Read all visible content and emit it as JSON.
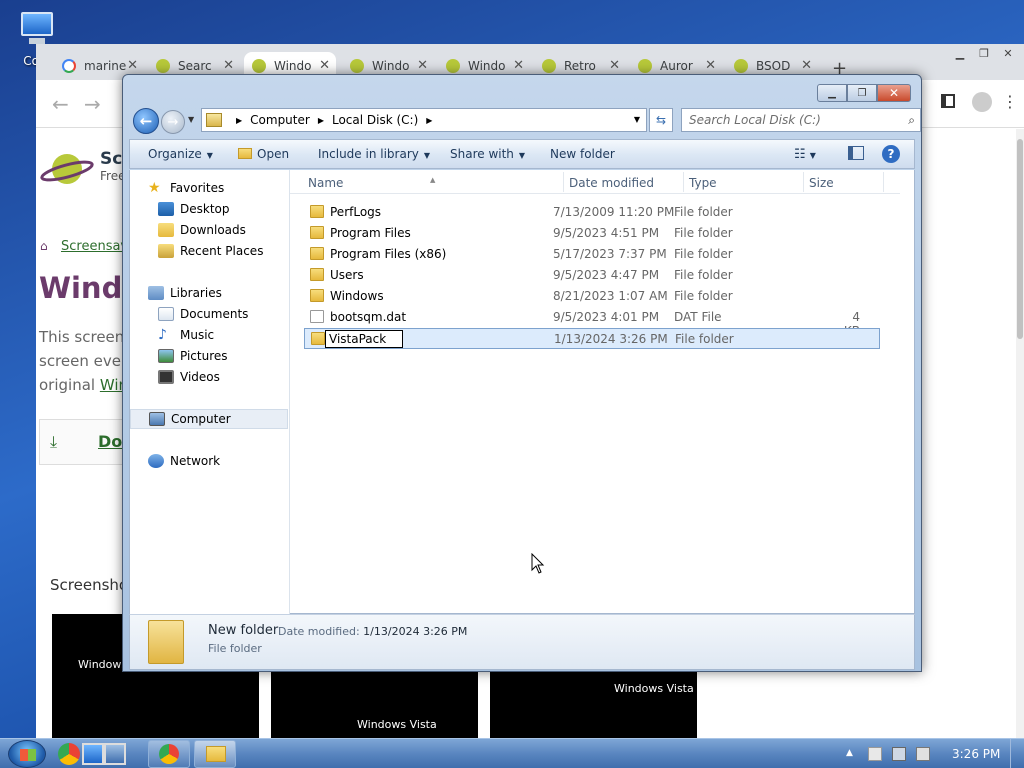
{
  "desktop": {
    "icon_label": "Com"
  },
  "browser": {
    "tabs": [
      {
        "title": "marine",
        "favicon_color": "#ffffff",
        "icon": "google-icon"
      },
      {
        "title": "Searc",
        "favicon_color": "#b8c93a",
        "icon": "saturn-icon"
      },
      {
        "title": "Windo",
        "favicon_color": "#b8c93a",
        "icon": "saturn-icon"
      },
      {
        "title": "Windo",
        "favicon_color": "#b8c93a",
        "icon": "saturn-icon"
      },
      {
        "title": "Windo",
        "favicon_color": "#b8c93a",
        "icon": "saturn-icon"
      },
      {
        "title": "Retro",
        "favicon_color": "#b8c93a",
        "icon": "saturn-icon"
      },
      {
        "title": "Auror",
        "favicon_color": "#b8c93a",
        "icon": "saturn-icon"
      },
      {
        "title": "BSOD",
        "favicon_color": "#b8c93a",
        "icon": "saturn-icon"
      }
    ],
    "page": {
      "site_name": "Scr",
      "site_sub": "Free",
      "breadcrumb": "Screensave",
      "title": "Windo",
      "desc_lines": [
        "This screens",
        "screen ever",
        "original "
      ],
      "desc_link": "Win",
      "download_label": "Do",
      "screenshots_label": "Screensho",
      "thumb_labels": [
        "Windows Vi",
        "Windows Vista",
        "Windows Vista"
      ]
    }
  },
  "explorer": {
    "breadcrumb": [
      "Computer",
      "Local Disk (C:)"
    ],
    "search_placeholder": "Search Local Disk (C:)",
    "toolbar": {
      "organize": "Organize",
      "open": "Open",
      "include": "Include in library",
      "share": "Share with",
      "new_folder": "New folder"
    },
    "nav": {
      "favorites": "Favorites",
      "desktop": "Desktop",
      "downloads": "Downloads",
      "recent": "Recent Places",
      "libraries": "Libraries",
      "documents": "Documents",
      "music": "Music",
      "pictures": "Pictures",
      "videos": "Videos",
      "computer": "Computer",
      "network": "Network"
    },
    "columns": {
      "name": "Name",
      "date": "Date modified",
      "type": "Type",
      "size": "Size"
    },
    "files": [
      {
        "name": "PerfLogs",
        "date": "7/13/2009 11:20 PM",
        "type": "File folder",
        "size": ""
      },
      {
        "name": "Program Files",
        "date": "9/5/2023 4:51 PM",
        "type": "File folder",
        "size": ""
      },
      {
        "name": "Program Files (x86)",
        "date": "5/17/2023 7:37 PM",
        "type": "File folder",
        "size": ""
      },
      {
        "name": "Users",
        "date": "9/5/2023 4:47 PM",
        "type": "File folder",
        "size": ""
      },
      {
        "name": "Windows",
        "date": "8/21/2023 1:07 AM",
        "type": "File folder",
        "size": ""
      },
      {
        "name": "bootsqm.dat",
        "date": "9/5/2023 4:01 PM",
        "type": "DAT File",
        "size": "4 KB"
      }
    ],
    "renaming": {
      "value": "VistaPack",
      "date": "1/13/2024 3:26 PM",
      "type": "File folder"
    },
    "details": {
      "name": "New folder",
      "date_label": "Date modified:",
      "date_value": "1/13/2024 3:26 PM",
      "type": "File folder"
    }
  },
  "taskbar": {
    "clock": "3:26 PM"
  }
}
